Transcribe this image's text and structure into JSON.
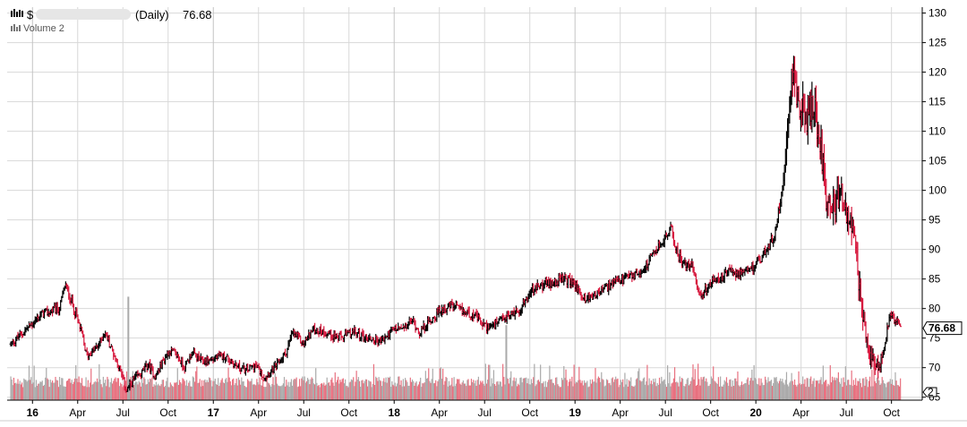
{
  "header": {
    "symbol": "$",
    "period": "(Daily)",
    "last_price": "76.68",
    "volume_label": "Volume 2",
    "volume_marker": "2"
  },
  "colors": {
    "up": "#000000",
    "down": "#d6173c",
    "volume_up": "#aaaaaa",
    "volume_down": "#e8707f",
    "grid": "#d8d8d8",
    "axis": "#000000"
  },
  "chart_data": {
    "type": "bar",
    "subtype": "ohlc-price-with-volume",
    "title": "",
    "xlabel": "",
    "ylabel": "",
    "ylim": [
      64.5,
      131
    ],
    "yticks": [
      65,
      70,
      75,
      80,
      85,
      90,
      95,
      100,
      105,
      110,
      115,
      120,
      125,
      130
    ],
    "ytick_labels": [
      "65",
      "70",
      "75",
      "80",
      "85",
      "90",
      "95",
      "100",
      "105",
      "110",
      "115",
      "120",
      "125",
      "130"
    ],
    "xlim": [
      2015.86,
      2020.92
    ],
    "x_ticks": [
      {
        "x": 2016.0,
        "label": "16",
        "year": true
      },
      {
        "x": 2016.25,
        "label": "Apr",
        "year": false
      },
      {
        "x": 2016.5,
        "label": "Jul",
        "year": false
      },
      {
        "x": 2016.75,
        "label": "Oct",
        "year": false
      },
      {
        "x": 2017.0,
        "label": "17",
        "year": true
      },
      {
        "x": 2017.25,
        "label": "Apr",
        "year": false
      },
      {
        "x": 2017.5,
        "label": "Jul",
        "year": false
      },
      {
        "x": 2017.75,
        "label": "Oct",
        "year": false
      },
      {
        "x": 2018.0,
        "label": "18",
        "year": true
      },
      {
        "x": 2018.25,
        "label": "Apr",
        "year": false
      },
      {
        "x": 2018.5,
        "label": "Jul",
        "year": false
      },
      {
        "x": 2018.75,
        "label": "Oct",
        "year": false
      },
      {
        "x": 2019.0,
        "label": "19",
        "year": true
      },
      {
        "x": 2019.25,
        "label": "Apr",
        "year": false
      },
      {
        "x": 2019.5,
        "label": "Jul",
        "year": false
      },
      {
        "x": 2019.75,
        "label": "Oct",
        "year": false
      },
      {
        "x": 2020.0,
        "label": "20",
        "year": true
      },
      {
        "x": 2020.25,
        "label": "Apr",
        "year": false
      },
      {
        "x": 2020.5,
        "label": "Jul",
        "year": false
      },
      {
        "x": 2020.75,
        "label": "Oct",
        "year": false
      }
    ],
    "last_value": 76.68,
    "grid": true,
    "series": [
      {
        "name": "Price",
        "points": [
          [
            2015.88,
            74
          ],
          [
            2015.95,
            76
          ],
          [
            2016.05,
            79
          ],
          [
            2016.15,
            80
          ],
          [
            2016.18,
            84
          ],
          [
            2016.22,
            81
          ],
          [
            2016.27,
            76
          ],
          [
            2016.3,
            72
          ],
          [
            2016.36,
            73.5
          ],
          [
            2016.4,
            76
          ],
          [
            2016.44,
            73
          ],
          [
            2016.48,
            70
          ],
          [
            2016.52,
            66
          ],
          [
            2016.56,
            68
          ],
          [
            2016.6,
            69
          ],
          [
            2016.64,
            70.5
          ],
          [
            2016.68,
            68.5
          ],
          [
            2016.72,
            71
          ],
          [
            2016.76,
            73
          ],
          [
            2016.8,
            72
          ],
          [
            2016.84,
            70
          ],
          [
            2016.88,
            72.5
          ],
          [
            2016.94,
            71
          ],
          [
            2017.0,
            71.5
          ],
          [
            2017.06,
            72
          ],
          [
            2017.12,
            70.5
          ],
          [
            2017.18,
            69.5
          ],
          [
            2017.23,
            70.5
          ],
          [
            2017.28,
            68.5
          ],
          [
            2017.34,
            70
          ],
          [
            2017.4,
            72.5
          ],
          [
            2017.44,
            76
          ],
          [
            2017.5,
            74
          ],
          [
            2017.55,
            76.5
          ],
          [
            2017.62,
            76
          ],
          [
            2017.7,
            75
          ],
          [
            2017.78,
            76
          ],
          [
            2017.85,
            75
          ],
          [
            2017.93,
            74.5
          ],
          [
            2018.0,
            76.5
          ],
          [
            2018.05,
            76.5
          ],
          [
            2018.1,
            78
          ],
          [
            2018.14,
            76
          ],
          [
            2018.2,
            78
          ],
          [
            2018.27,
            80
          ],
          [
            2018.32,
            80.5
          ],
          [
            2018.38,
            79.5
          ],
          [
            2018.44,
            79
          ],
          [
            2018.5,
            77
          ],
          [
            2018.55,
            77
          ],
          [
            2018.62,
            78.5
          ],
          [
            2018.7,
            80
          ],
          [
            2018.76,
            83
          ],
          [
            2018.82,
            84
          ],
          [
            2018.88,
            84.5
          ],
          [
            2018.95,
            85
          ],
          [
            2019.0,
            84
          ],
          [
            2019.05,
            81.5
          ],
          [
            2019.12,
            82.5
          ],
          [
            2019.2,
            84
          ],
          [
            2019.28,
            85
          ],
          [
            2019.35,
            86
          ],
          [
            2019.4,
            87.5
          ],
          [
            2019.45,
            90
          ],
          [
            2019.5,
            92
          ],
          [
            2019.53,
            93.5
          ],
          [
            2019.57,
            89
          ],
          [
            2019.62,
            87
          ],
          [
            2019.65,
            87.5
          ],
          [
            2019.69,
            82
          ],
          [
            2019.74,
            84
          ],
          [
            2019.8,
            85
          ],
          [
            2019.87,
            86.5
          ],
          [
            2019.93,
            85.5
          ],
          [
            2019.98,
            87
          ],
          [
            2020.04,
            89
          ],
          [
            2020.1,
            92
          ],
          [
            2020.15,
            101
          ],
          [
            2020.18,
            114
          ],
          [
            2020.2,
            121
          ],
          [
            2020.23,
            116
          ],
          [
            2020.27,
            112
          ],
          [
            2020.32,
            114
          ],
          [
            2020.36,
            108
          ],
          [
            2020.39,
            99
          ],
          [
            2020.43,
            97
          ],
          [
            2020.47,
            99
          ],
          [
            2020.51,
            96
          ],
          [
            2020.55,
            90
          ],
          [
            2020.58,
            81
          ],
          [
            2020.62,
            72.5
          ],
          [
            2020.66,
            71
          ],
          [
            2020.7,
            72
          ],
          [
            2020.74,
            79
          ],
          [
            2020.78,
            78
          ],
          [
            2020.8,
            76.68
          ]
        ]
      },
      {
        "name": "Volume",
        "spikes": [
          {
            "x": 2016.53,
            "level": 0.91
          },
          {
            "x": 2018.62,
            "level": 0.66
          },
          {
            "x": 2018.25,
            "level": 0.18
          }
        ]
      }
    ]
  }
}
